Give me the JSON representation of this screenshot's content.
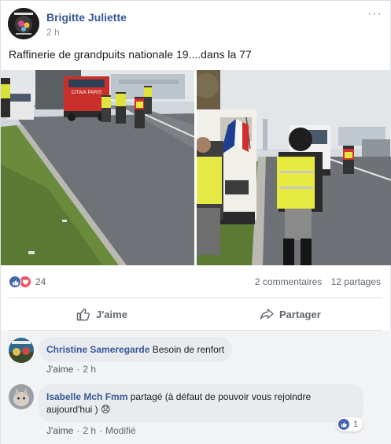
{
  "post": {
    "author": "Brigitte Juliette",
    "time": "2 h",
    "more_label": "···",
    "text": "Raffinerie de grandpuits nationale 19....dans la 77",
    "photo_1_truck_text": "CITAIX PARIS"
  },
  "stats": {
    "reaction_count": "24",
    "comments_label": "2 commentaires",
    "shares_label": "12 partages"
  },
  "actions": {
    "like_label": "J'aime",
    "share_label": "Partager"
  },
  "comments": [
    {
      "author": "Christine Sameregarde",
      "text": "Besoin de renfort",
      "like_label": "J'aime",
      "time": "2 h"
    },
    {
      "author": "Isabelle Mch Fmm",
      "text": "partagé (à défaut de pouvoir vous rejoindre aujourd'hui )",
      "emoji": "😞",
      "like_label": "J'aime",
      "time": "2 h",
      "edited_label": "Modifié",
      "reaction_count": "1"
    }
  ],
  "colors": {
    "link_blue": "#365899",
    "like_blue": "#4267b2",
    "love_red": "#f25268",
    "comment_bg": "#f2f3f5",
    "bubble_bg": "#e9ebee"
  },
  "icons": {
    "more": "ellipsis-icon",
    "like_action": "thumbs-up-outline-icon",
    "share_action": "share-arrow-icon",
    "like_reaction": "like-reaction-icon",
    "love_reaction": "love-reaction-icon"
  }
}
